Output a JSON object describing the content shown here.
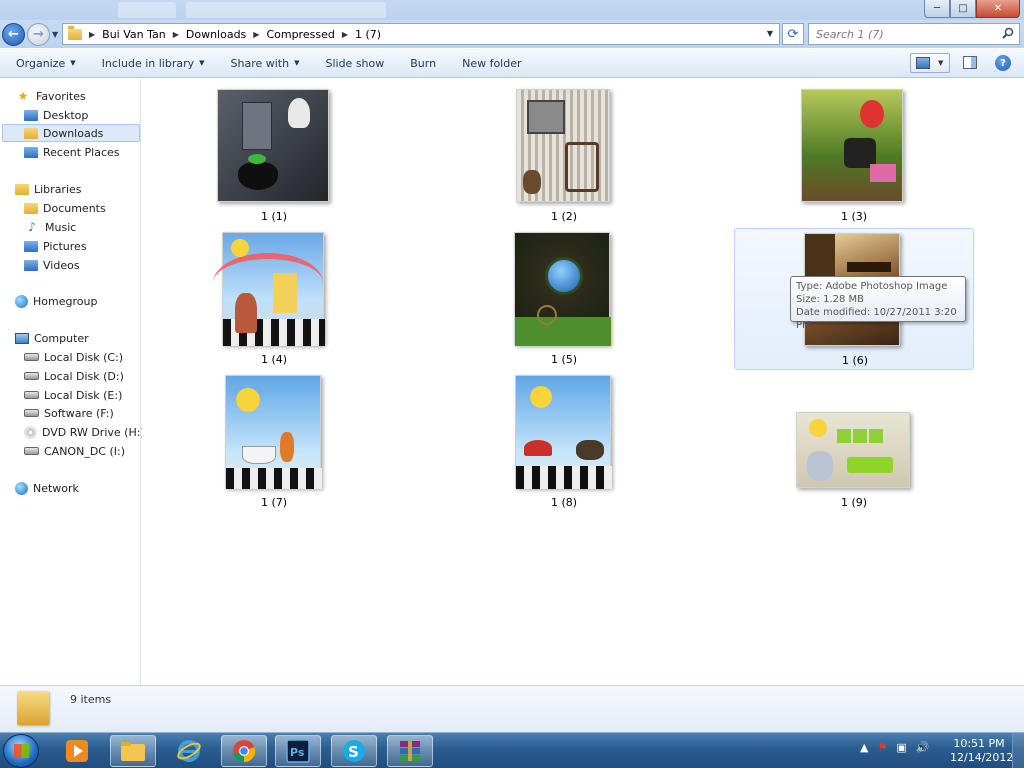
{
  "window": {
    "controls": {
      "minimize": "─",
      "maximize": "□",
      "close": "✕"
    }
  },
  "address": {
    "crumbs": [
      "Bui Van Tan",
      "Downloads",
      "Compressed",
      "1 (7)"
    ],
    "search_placeholder": "Search 1 (7)"
  },
  "toolbar": {
    "organize": "Organize",
    "include_in_library": "Include in library",
    "share_with": "Share with",
    "slide_show": "Slide show",
    "burn": "Burn",
    "new_folder": "New folder"
  },
  "sidebar": {
    "favorites": {
      "header": "Favorites",
      "items": [
        "Desktop",
        "Downloads",
        "Recent Places"
      ]
    },
    "libraries": {
      "header": "Libraries",
      "items": [
        "Documents",
        "Music",
        "Pictures",
        "Videos"
      ]
    },
    "homegroup": "Homegroup",
    "computer": {
      "header": "Computer",
      "items": [
        "Local Disk (C:)",
        "Local Disk (D:)",
        "Local Disk (E:)",
        "Software (F:)",
        "DVD RW Drive (H:)",
        "CANON_DC (I:)"
      ]
    },
    "network": "Network",
    "selected": "Downloads"
  },
  "files": [
    {
      "name": "1 (1)",
      "color": "#3b3f46"
    },
    {
      "name": "1 (2)",
      "color": "#c9c2b5"
    },
    {
      "name": "1 (3)",
      "color": "#7a9a3a"
    },
    {
      "name": "1 (4)",
      "color": "#8fc1ea"
    },
    {
      "name": "1 (5)",
      "color": "#3f5a2a"
    },
    {
      "name": "1 (6)",
      "color": "#6b4a28"
    },
    {
      "name": "1 (7)",
      "color": "#8fc4ec"
    },
    {
      "name": "1 (8)",
      "color": "#86b9e2"
    },
    {
      "name": "1 (9)",
      "color": "#d8d3c0"
    }
  ],
  "tooltip": {
    "type": "Type: Adobe Photoshop Image",
    "size": "Size: 1.28 MB",
    "date": "Date modified: 10/27/2011 3:20 PM"
  },
  "details": {
    "count": "9 items"
  },
  "taskbar": {
    "time": "10:51 PM",
    "date": "12/14/2012",
    "apps": [
      "windows-media-player",
      "windows-explorer",
      "internet-explorer",
      "google-chrome",
      "adobe-photoshop",
      "skype",
      "winrar"
    ]
  }
}
